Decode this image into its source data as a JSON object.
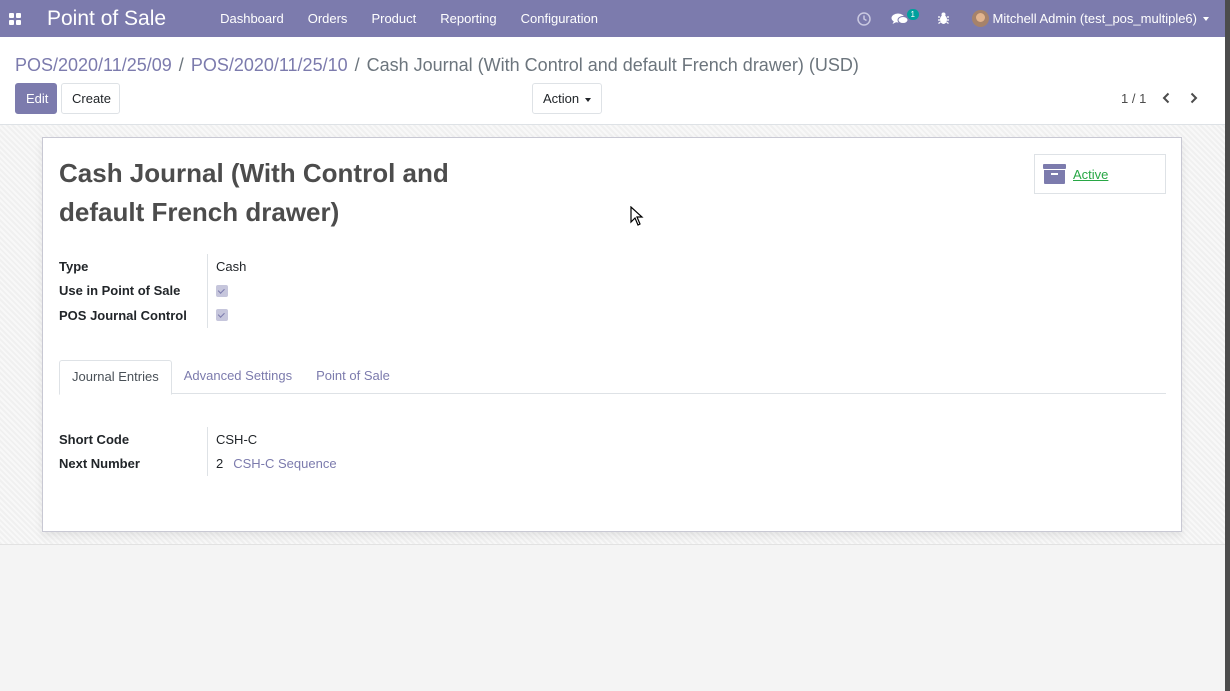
{
  "navbar": {
    "brand": "Point of Sale",
    "menu": [
      {
        "label": "Dashboard"
      },
      {
        "label": "Orders"
      },
      {
        "label": "Product"
      },
      {
        "label": "Reporting"
      },
      {
        "label": "Configuration"
      }
    ],
    "messages_count": "1",
    "user": "Mitchell Admin (test_pos_multiple6)"
  },
  "breadcrumb": {
    "items": [
      "POS/2020/11/25/09",
      "POS/2020/11/25/10"
    ],
    "current": "Cash Journal (With Control and default French drawer) (USD)",
    "separator": "/"
  },
  "toolbar": {
    "edit_label": "Edit",
    "create_label": "Create",
    "action_label": "Action",
    "pager": "1 / 1"
  },
  "record": {
    "title": "Cash Journal (With Control and default French drawer)",
    "active_label": "Active",
    "fields": {
      "type_label": "Type",
      "type_value": "Cash",
      "use_in_pos_label": "Use in Point of Sale",
      "use_in_pos_checked": true,
      "pos_journal_control_label": "POS Journal Control",
      "pos_journal_control_checked": true
    },
    "tabs": [
      {
        "label": "Journal Entries",
        "active": true
      },
      {
        "label": "Advanced Settings",
        "active": false
      },
      {
        "label": "Point of Sale",
        "active": false
      }
    ],
    "journal_entries": {
      "short_code_label": "Short Code",
      "short_code_value": "CSH-C",
      "next_number_label": "Next Number",
      "next_number_value": "2",
      "sequence_link": "CSH-C Sequence"
    }
  },
  "colors": {
    "brand": "#7c7bad",
    "active_green": "#28a745"
  }
}
